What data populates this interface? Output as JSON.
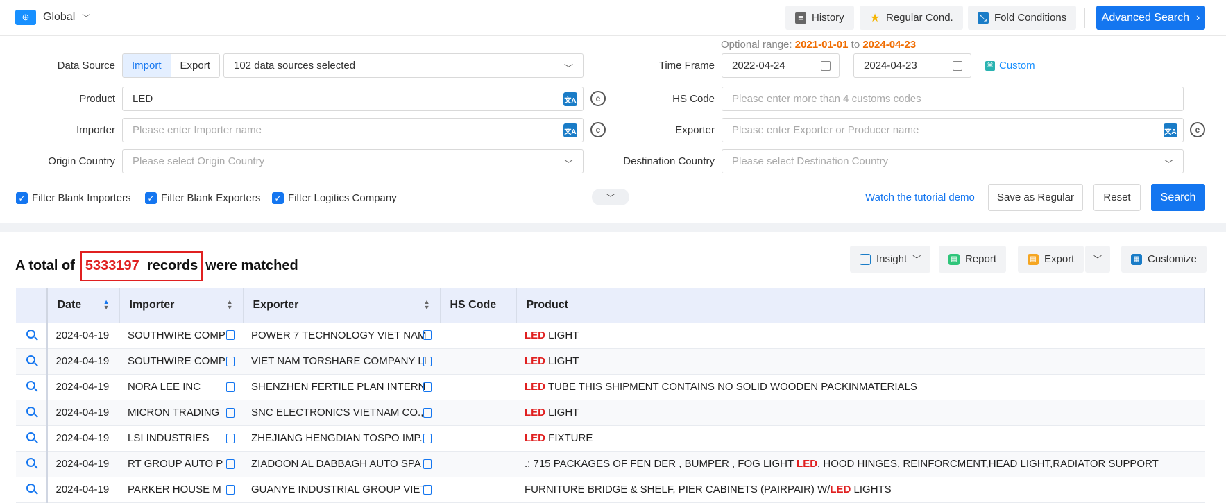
{
  "header": {
    "region": "Global",
    "history": "History",
    "regular_cond": "Regular Cond.",
    "fold_conditions": "Fold Conditions",
    "advanced_search": "Advanced Search"
  },
  "form": {
    "data_source_label": "Data Source",
    "import_label": "Import",
    "export_label": "Export",
    "sources_selected": "102 data sources selected",
    "product_label": "Product",
    "product_value": "LED",
    "importer_label": "Importer",
    "importer_placeholder": "Please enter Importer name",
    "origin_label": "Origin Country",
    "origin_placeholder": "Please select Origin Country",
    "optional_prefix": "Optional range:",
    "optional_from": "2021-01-01",
    "optional_to_word": "to",
    "optional_to": "2024-04-23",
    "time_frame_label": "Time Frame",
    "date_from": "2022-04-24",
    "date_to": "2024-04-23",
    "custom_label": "Custom",
    "hs_label": "HS Code",
    "hs_placeholder": "Please enter more than 4 customs codes",
    "exporter_label": "Exporter",
    "exporter_placeholder": "Please enter Exporter or Producer name",
    "destination_label": "Destination Country",
    "destination_placeholder": "Please select Destination Country",
    "filter_importers": "Filter Blank Importers",
    "filter_exporters": "Filter Blank Exporters",
    "filter_logistics": "Filter Logitics Company",
    "watch_tutorial": "Watch the tutorial demo",
    "save_regular": "Save as Regular",
    "reset": "Reset",
    "search": "Search"
  },
  "results": {
    "prefix": "A total of",
    "count": "5333197",
    "records_word": "records",
    "suffix": "were matched",
    "insight": "Insight",
    "report": "Report",
    "export": "Export",
    "customize": "Customize",
    "columns": [
      "Date",
      "Importer",
      "Exporter",
      "HS Code",
      "Product"
    ],
    "rows": [
      {
        "date": "2024-04-19",
        "importer": "SOUTHWIRE COMP",
        "exporter": "POWER 7 TECHNOLOGY VIET NAM",
        "hs": "",
        "pre": "",
        "kw": "LED",
        "post": " LIGHT"
      },
      {
        "date": "2024-04-19",
        "importer": "SOUTHWIRE COMP",
        "exporter": "VIET NAM TORSHARE COMPANY LI",
        "hs": "",
        "pre": "",
        "kw": "LED",
        "post": " LIGHT"
      },
      {
        "date": "2024-04-19",
        "importer": "NORA LEE INC",
        "exporter": "SHENZHEN FERTILE PLAN INTERN",
        "hs": "",
        "pre": "",
        "kw": "LED",
        "post": " TUBE THIS SHIPMENT CONTAINS NO SOLID WOODEN PACKINMATERIALS"
      },
      {
        "date": "2024-04-19",
        "importer": "MICRON TRADING",
        "exporter": "SNC ELECTRONICS VIETNAM CO.,",
        "hs": "",
        "pre": "",
        "kw": "LED",
        "post": " LIGHT"
      },
      {
        "date": "2024-04-19",
        "importer": "LSI INDUSTRIES",
        "exporter": "ZHEJIANG HENGDIAN TOSPO IMP.",
        "hs": "",
        "pre": "",
        "kw": "LED",
        "post": " FIXTURE"
      },
      {
        "date": "2024-04-19",
        "importer": "RT GROUP AUTO P",
        "exporter": "ZIADOON AL DABBAGH AUTO SPA",
        "hs": "",
        "pre": ".: 715 PACKAGES OF FEN DER , BUMPER , FOG LIGHT ",
        "kw": "LED",
        "post": ", HOOD HINGES, REINFORCMENT,HEAD LIGHT,RADIATOR SUPPORT"
      },
      {
        "date": "2024-04-19",
        "importer": "PARKER HOUSE M",
        "exporter": "GUANYE INDUSTRIAL GROUP VIET",
        "hs": "",
        "pre": "FURNITURE BRIDGE & SHELF, PIER CABINETS (PAIRPAIR) W/",
        "kw": "LED",
        "post": " LIGHTS"
      }
    ]
  }
}
